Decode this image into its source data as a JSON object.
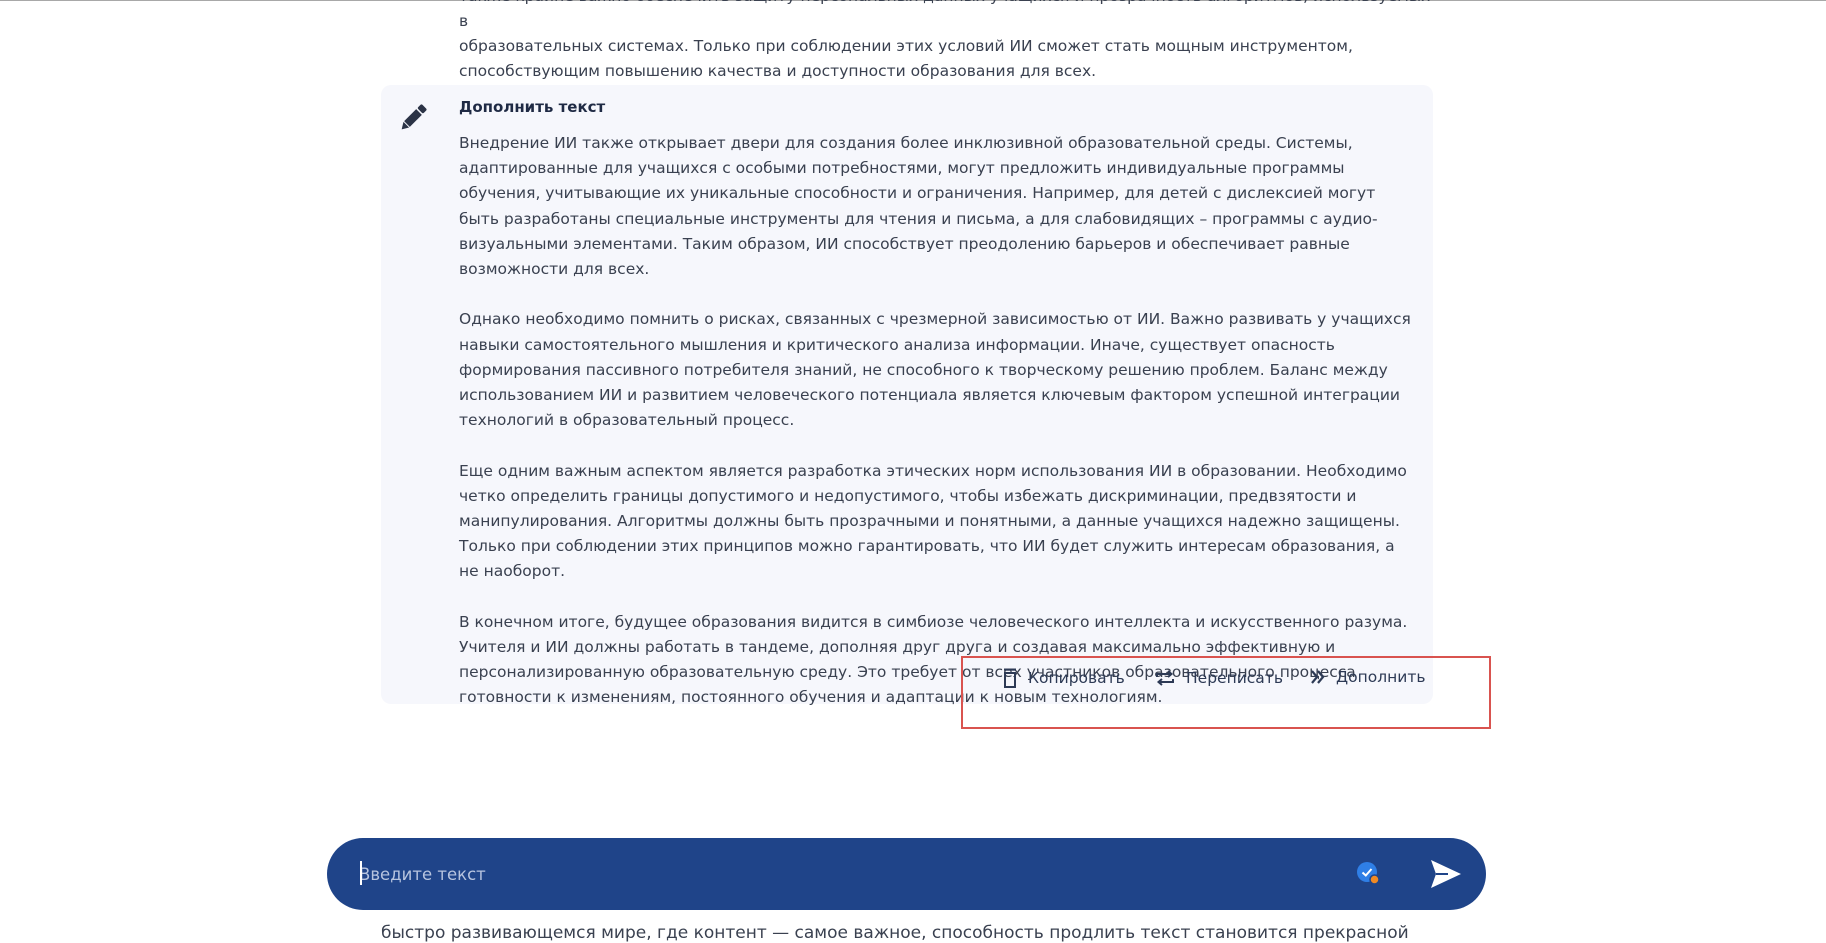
{
  "previous_message": {
    "line1": "также крайне важно обеспечить защиту персональных данных учащихся и прозрачность алгоритмов, используемых в",
    "line2": "образовательных системах. Только при соблюдении этих условий ИИ сможет стать мощным инструментом,",
    "line3": "способствующим повышению качества и доступности образования для всех."
  },
  "card": {
    "title": "Дополнить текст",
    "paragraphs": [
      "Внедрение ИИ также открывает двери для создания более инклюзивной образовательной среды. Системы, адаптированные для учащихся с особыми потребностями, могут предложить индивидуальные программы обучения, учитывающие их уникальные способности и ограничения. Например, для детей с дислексией могут быть разработаны специальные инструменты для чтения и письма, а для слабовидящих – программы с аудио-визуальными элементами. Таким образом, ИИ способствует преодолению барьеров и обеспечивает равные возможности для всех.",
      "Однако необходимо помнить о рисках, связанных с чрезмерной зависимостью от ИИ. Важно развивать у учащихся навыки самостоятельного мышления и критического анализа информации. Иначе, существует опасность формирования пассивного потребителя знаний, не способного к творческому решению проблем. Баланс между использованием ИИ и развитием человеческого потенциала является ключевым фактором успешной интеграции технологий в образовательный процесс.",
      "Еще одним важным аспектом является разработка этических норм использования ИИ в образовании. Необходимо четко определить границы допустимого и недопустимого, чтобы избежать дискриминации, предвзятости и манипулирования. Алгоритмы должны быть прозрачными и понятными, а данные учащихся надежно защищены. Только при соблюдении этих принципов можно гарантировать, что ИИ будет служить интересам образования, а не наоборот.",
      "В конечном итоге, будущее образования видится в симбиозе человеческого интеллекта и искусственного разума. Учителя и ИИ должны работать в тандеме, дополняя друг друга и создавая максимально эффективную и персонализированную образовательную среду. Это требует от всех участников образовательного процесса готовности к изменениям, постоянного обучения и адаптации к новым технологиям."
    ]
  },
  "actions": {
    "copy": "Копировать",
    "rewrite": "Переписать",
    "continue": "Дополнить"
  },
  "input": {
    "placeholder": "Введите текст"
  },
  "next_message": {
    "visible_line": "быстро развивающемся мире, где контент — самое важное, способность продлить текст становится прекрасной"
  },
  "colors": {
    "input_bar": "#1f4489",
    "card_background": "#f6f7fc",
    "highlight_frame": "#d9534f",
    "badge_blue": "#2f7fe6",
    "badge_orange": "#f08a24"
  }
}
